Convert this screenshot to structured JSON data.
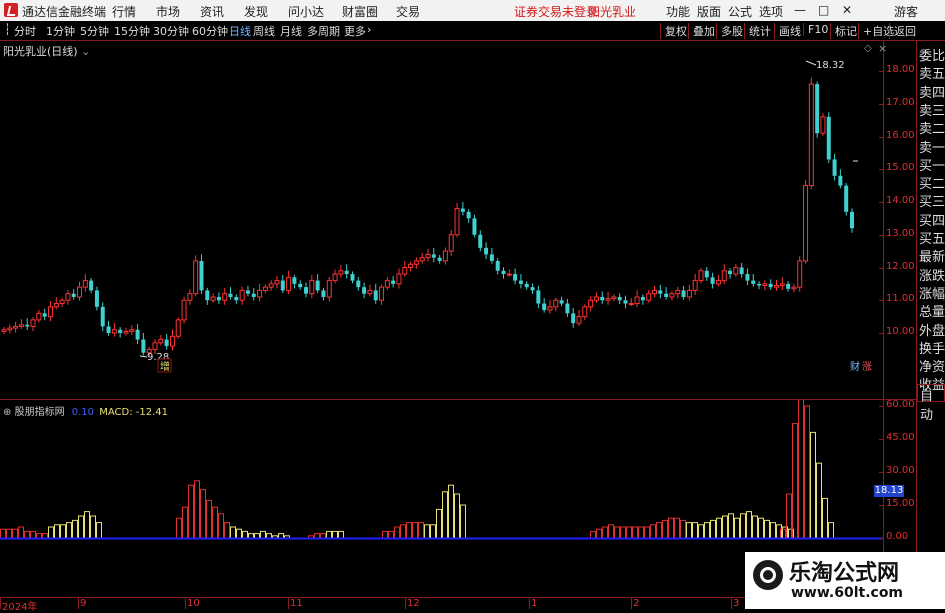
{
  "titlebar": {
    "app_name": "通达信金融终端",
    "menu": [
      "行情",
      "市场",
      "资讯",
      "发现",
      "问小达",
      "财富圈",
      "交易"
    ],
    "notice": "证券交易未登录",
    "stock": "阳光乳业",
    "right_menu": [
      "功能",
      "版面",
      "公式",
      "选项"
    ],
    "guest": "游客",
    "controls": [
      "—",
      "□",
      "✕"
    ]
  },
  "toolbar": {
    "periods": [
      "分时",
      "1分钟",
      "5分钟",
      "15分钟",
      "30分钟",
      "60分钟",
      "日线",
      "周线",
      "月线",
      "多周期",
      "更多"
    ],
    "active_period": "日线",
    "right_buttons": [
      "复权",
      "叠加",
      "多股",
      "统计",
      "画线",
      "F10",
      "标记",
      "+自选",
      "返回"
    ]
  },
  "main_chart": {
    "stock_title": "阳光乳业(日线)",
    "high_label": "18.32",
    "low_label": "9.28",
    "mark_zeng": "增",
    "mark_cai": "财",
    "mark_zhang": "涨",
    "y_ticks": [
      "18.00",
      "17.00",
      "16.00",
      "15.00",
      "14.00",
      "13.00",
      "12.00",
      "11.00",
      "10.00"
    ]
  },
  "sidebar": [
    "委比",
    "卖五",
    "卖四",
    "卖三",
    "卖二",
    "卖一",
    "买一",
    "买二",
    "买三",
    "买四",
    "买五",
    "最新",
    "涨跌",
    "涨幅",
    "总量",
    "外盘",
    "换手",
    "净资",
    "收益"
  ],
  "indicator": {
    "name": "股朋指标网",
    "value_blue": "0.10",
    "macd_label": "MACD: -12.41",
    "auto_button": "自动",
    "current_value": "18.13",
    "y_ticks": [
      "60.00",
      "45.00",
      "30.00",
      "15.00",
      "0.00"
    ]
  },
  "x_axis": [
    "2024年",
    "9",
    "10",
    "11",
    "12",
    "1",
    "2",
    "3"
  ],
  "watermark": {
    "line1": "乐淘公式网",
    "line2": "www.60lt.com"
  },
  "colors": {
    "up": "#ff3232",
    "down": "#3fd0d0",
    "vol_up": "#e03030",
    "vol_down": "#e8e070",
    "grid": "#8b1a1a",
    "baseline": "#2020ff"
  },
  "chart_data": {
    "type": "candlestick",
    "closes": [
      10.1,
      10.15,
      10.2,
      10.25,
      10.2,
      10.4,
      10.6,
      10.5,
      10.8,
      10.9,
      11.0,
      11.2,
      11.1,
      11.4,
      11.6,
      11.3,
      10.8,
      10.2,
      10.0,
      10.1,
      10.0,
      10.05,
      10.1,
      9.8,
      9.4,
      9.5,
      9.7,
      9.8,
      9.6,
      9.9,
      10.4,
      11.0,
      11.2,
      12.2,
      11.3,
      11.0,
      11.1,
      11.0,
      11.2,
      11.1,
      11.0,
      11.3,
      11.2,
      11.1,
      11.3,
      11.4,
      11.5,
      11.6,
      11.3,
      11.7,
      11.5,
      11.4,
      11.2,
      11.6,
      11.3,
      11.1,
      11.6,
      11.8,
      11.9,
      11.8,
      11.6,
      11.4,
      11.2,
      11.3,
      11.0,
      11.4,
      11.6,
      11.5,
      11.8,
      12.0,
      12.1,
      12.2,
      12.3,
      12.4,
      12.3,
      12.2,
      12.5,
      13.0,
      13.8,
      13.7,
      13.5,
      13.0,
      12.6,
      12.4,
      12.2,
      11.9,
      11.8,
      11.8,
      11.6,
      11.5,
      11.4,
      11.3,
      10.9,
      10.7,
      10.8,
      11.0,
      10.9,
      10.6,
      10.3,
      10.5,
      10.8,
      11.0,
      11.1,
      11.0,
      11.05,
      11.1,
      11.0,
      10.9,
      10.9,
      11.1,
      11.0,
      11.2,
      11.3,
      11.2,
      11.1,
      11.2,
      11.3,
      11.1,
      11.3,
      11.6,
      11.9,
      11.7,
      11.5,
      11.6,
      11.9,
      11.8,
      12.0,
      11.8,
      11.6,
      11.5,
      11.45,
      11.5,
      11.4,
      11.45,
      11.5,
      11.35,
      11.4,
      12.2,
      14.5,
      17.6,
      16.1,
      16.6,
      15.3,
      14.8,
      14.5,
      13.7,
      13.2
    ]
  }
}
